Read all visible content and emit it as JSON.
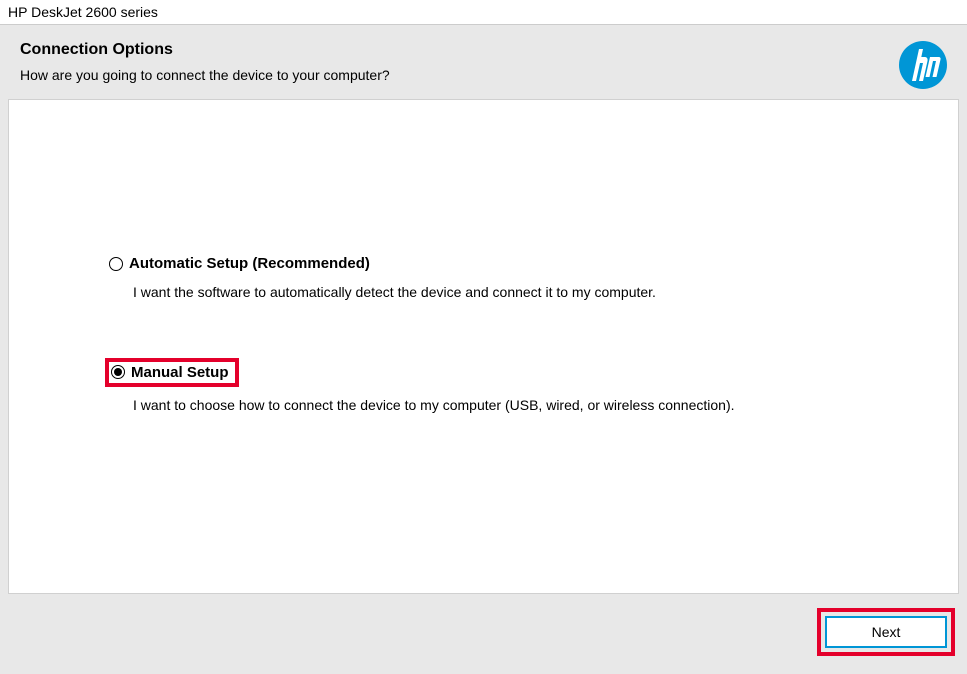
{
  "window": {
    "title": "HP DeskJet 2600 series"
  },
  "header": {
    "title": "Connection Options",
    "subtitle": "How are you going to connect the device to your computer?"
  },
  "options": {
    "auto": {
      "label": "Automatic Setup (Recommended)",
      "desc": "I want the software to automatically detect the device and connect it to my computer.",
      "selected": false
    },
    "manual": {
      "label": "Manual Setup",
      "desc": "I want to choose how to connect the device to my computer (USB, wired, or wireless connection).",
      "selected": true
    }
  },
  "footer": {
    "next_label": "Next"
  },
  "brand": {
    "logo_name": "hp-logo",
    "accent_color": "#0096d6",
    "highlight_color": "#e4002b"
  }
}
